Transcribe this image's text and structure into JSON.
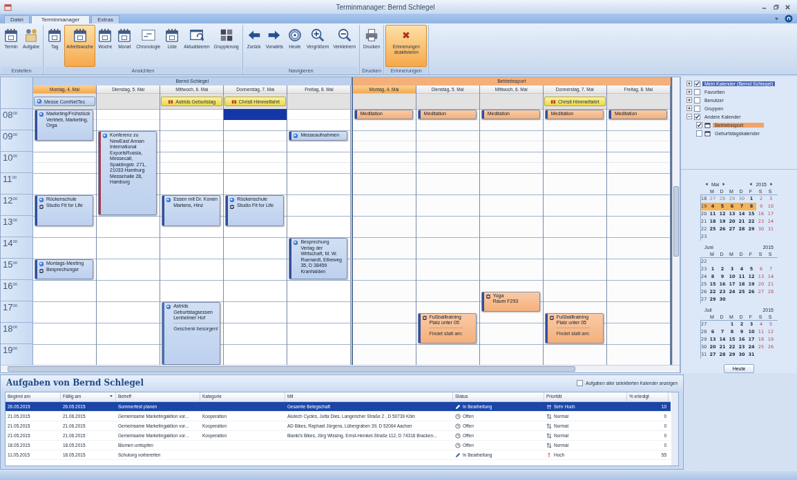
{
  "window": {
    "title": "Terminmanager: Bernd Schlegel"
  },
  "ribbon": {
    "tabs": [
      {
        "label": "Datei",
        "selected": false
      },
      {
        "label": "Terminmanager",
        "selected": true
      },
      {
        "label": "Extras",
        "selected": false
      }
    ],
    "groups": [
      {
        "label": "Erstellen",
        "buttons": [
          {
            "label": "Termin",
            "kind": "appointment",
            "selected": false
          },
          {
            "label": "Aufgabe",
            "kind": "task",
            "selected": false
          }
        ]
      },
      {
        "label": "Ansichten",
        "buttons": [
          {
            "label": "Tag",
            "kind": "day",
            "selected": false
          },
          {
            "label": "Arbeitswoche",
            "kind": "workweek",
            "selected": true
          },
          {
            "label": "Woche",
            "kind": "week",
            "selected": false
          },
          {
            "label": "Monat",
            "kind": "month",
            "selected": false
          },
          {
            "label": "Chronologie",
            "kind": "timeline",
            "selected": false
          },
          {
            "label": "Liste",
            "kind": "list",
            "selected": false
          },
          {
            "label": "Aktualisieren",
            "kind": "refresh",
            "selected": false
          },
          {
            "label": "Gruppierung",
            "kind": "grouping",
            "selected": false
          }
        ]
      },
      {
        "label": "Navigieren",
        "buttons": [
          {
            "label": "Zurück",
            "kind": "back",
            "selected": false
          },
          {
            "label": "Vorwärts",
            "kind": "forward",
            "selected": false
          },
          {
            "label": "Heute",
            "kind": "today",
            "selected": false
          },
          {
            "label": "Vergrößern",
            "kind": "zoom-in",
            "selected": false
          },
          {
            "label": "Verkleinern",
            "kind": "zoom-out",
            "selected": false
          }
        ]
      },
      {
        "label": "Drucken",
        "buttons": [
          {
            "label": "Drucken",
            "kind": "print",
            "selected": false
          }
        ]
      },
      {
        "label": "Erinnerungen",
        "buttons": [
          {
            "label": "Erinnerungen deaktivieren",
            "kind": "reminder-off",
            "selected": true
          }
        ]
      }
    ]
  },
  "calendar": {
    "hours": [
      "08$^{00}$",
      "09$^{00}$",
      "10$^{00}$",
      "11$^{00}$",
      "12$^{00}$",
      "13$^{00}$",
      "14$^{00}$",
      "15$^{00}$",
      "16$^{00}$",
      "17$^{00}$",
      "18$^{00}$",
      "19$^{00}$"
    ],
    "groups": [
      {
        "name": "Bernd Schlegel",
        "color": "#bcd0ee",
        "days": [
          {
            "label": "Montag, 4. Mai",
            "today": true,
            "selection": false,
            "all_day": [
              {
                "title": "Messe ComNetTec",
                "kind": "event"
              }
            ],
            "events": [
              {
                "title": "Marketing/Frühstück",
                "lines": [
                  "Vertrieb, Marketing, Orga"
                ],
                "recurring": false,
                "color": "#2f4f9e"
              },
              {
                "title": "Rückenschule",
                "lines": [
                  "Studio Fit for Life"
                ],
                "recurring": true,
                "color": "#2f4f9e"
              },
              {
                "title": "Montags-Meeting",
                "lines": [
                  "Besprechungsr"
                ],
                "recurring": true,
                "color": "#2f4f9e"
              }
            ]
          },
          {
            "label": "Dienstag, 5. Mai",
            "today": false,
            "selection": false,
            "events": [
              {
                "title": "Konferenz zu NewEast Annan International",
                "lines": [
                  "ExportsRussia, Messecall, Spaldingstr. 271, 21033 Hamburg",
                  "Messehalle 28, Hamburg"
                ],
                "recurring": false,
                "color": "#a33a48"
              }
            ]
          },
          {
            "label": "Mittwoch, 6. Mai",
            "today": false,
            "selection": false,
            "all_day": [
              {
                "title": "Astrids Geburtstag",
                "kind": "holiday"
              }
            ],
            "events": [
              {
                "title": "Essen mit Dr. Konen Martens, Hinz",
                "recurring": false,
                "color": "#2f4f9e"
              },
              {
                "title": "Astrids Geburtstagsessen Lenheimer Hof",
                "note": "Geschenk besorgen!",
                "recurring": false,
                "color": "#4a6fb5"
              }
            ]
          },
          {
            "label": "Donnerstag, 7. Mai",
            "today": false,
            "selection": true,
            "all_day": [
              {
                "title": "Christi Himmelfahrt",
                "kind": "holiday"
              }
            ],
            "events": [
              {
                "title": "Rückenschule",
                "lines": [
                  "Studio Fit for Life"
                ],
                "recurring": true,
                "color": "#2f4f9e"
              }
            ]
          },
          {
            "label": "Freitag, 8. Mai",
            "today": false,
            "selection": false,
            "events": [
              {
                "title": "Messeaufnahmen",
                "recurring": false,
                "color": "#2f4f9e"
              },
              {
                "title": "Besprechung",
                "lines": [
                  "Verlag der Wirtschaft, M. W. Ruenardt, Elbeweg 35, D 38459 Kranhalden"
                ],
                "recurring": false,
                "color": "#2f4f9e"
              }
            ]
          }
        ]
      },
      {
        "name": "Betriebssport",
        "color": "#f5b07a",
        "days": [
          {
            "label": "Montag, 4. Mai",
            "today": true,
            "selection": false,
            "events": [
              {
                "title": "Meditation",
                "recurring": false,
                "color": "#2f4f9e"
              }
            ]
          },
          {
            "label": "Dienstag, 5. Mai",
            "today": false,
            "selection": false,
            "events": [
              {
                "title": "Meditation",
                "recurring": false,
                "color": "#2f4f9e"
              },
              {
                "title": "Fußballtraining",
                "lines": [
                  "Platz unter 05"
                ],
                "note": "Findet statt am:",
                "recurring": true,
                "color": "#2f4f9e"
              }
            ]
          },
          {
            "label": "Mittwoch, 6. Mai",
            "today": false,
            "selection": false,
            "events": [
              {
                "title": "Meditation",
                "recurring": false,
                "color": "#2f4f9e"
              },
              {
                "title": "Yoga",
                "lines": [
                  "Raum F293"
                ],
                "recurring": true,
                "color": "#2f4f9e"
              }
            ]
          },
          {
            "label": "Donnerstag, 7. Mai",
            "today": false,
            "selection": false,
            "all_day": [
              {
                "title": "Christi Himmelfahrt",
                "kind": "holiday"
              }
            ],
            "events": [
              {
                "title": "Meditation",
                "recurring": false,
                "color": "#2f4f9e"
              },
              {
                "title": "Fußballtraining",
                "lines": [
                  "Platz unter 05"
                ],
                "note": "Findet statt am:",
                "recurring": true,
                "color": "#2f4f9e"
              }
            ]
          },
          {
            "label": "Freitag, 8. Mai",
            "today": false,
            "selection": false,
            "events": [
              {
                "title": "Meditation",
                "recurring": false,
                "color": "#2f4f9e"
              }
            ]
          }
        ]
      }
    ]
  },
  "navigator": {
    "tree": [
      {
        "label": "Mein Kalender (Bernd Schlegel)",
        "checked": true,
        "selected": true,
        "expanded": false
      },
      {
        "label": "Favoriten",
        "checked": false,
        "selected": false,
        "expanded": false
      },
      {
        "label": "Benutzer",
        "checked": false,
        "selected": false,
        "expanded": false
      },
      {
        "label": "Gruppen",
        "checked": false,
        "selected": false,
        "expanded": false
      },
      {
        "label": "Andere Kalender",
        "checked": true,
        "selected": false,
        "expanded": true,
        "children": [
          {
            "label": "Betriebssport",
            "checked": true,
            "selected": true
          },
          {
            "label": "Geburtstagskalender",
            "checked": false,
            "selected": false
          }
        ]
      }
    ],
    "months": [
      {
        "month": "Mai",
        "year": "2015",
        "weekdays": [
          "M",
          "D",
          "M",
          "D",
          "F",
          "S",
          "S"
        ],
        "weeks": [
          {
            "week": "18",
            "selected": false,
            "days": [
              {
                "d": "27",
                "kind": "other"
              },
              {
                "d": "28",
                "kind": "other"
              },
              {
                "d": "29",
                "kind": "other"
              },
              {
                "d": "30",
                "kind": "other"
              },
              {
                "d": "1",
                "kind": "day"
              },
              {
                "d": "2",
                "kind": "weekend"
              },
              {
                "d": "3",
                "kind": "weekend"
              }
            ]
          },
          {
            "week": "19",
            "selected": true,
            "days": [
              {
                "d": "4",
                "kind": "day"
              },
              {
                "d": "5",
                "kind": "day"
              },
              {
                "d": "6",
                "kind": "day"
              },
              {
                "d": "7",
                "kind": "day"
              },
              {
                "d": "8",
                "kind": "day"
              },
              {
                "d": "9",
                "kind": "weekend"
              },
              {
                "d": "10",
                "kind": "weekend"
              }
            ]
          },
          {
            "week": "20",
            "selected": false,
            "days": [
              {
                "d": "11",
                "kind": "day"
              },
              {
                "d": "12",
                "kind": "day"
              },
              {
                "d": "13",
                "kind": "day"
              },
              {
                "d": "14",
                "kind": "day"
              },
              {
                "d": "15",
                "kind": "day"
              },
              {
                "d": "16",
                "kind": "weekend"
              },
              {
                "d": "17",
                "kind": "weekend"
              }
            ]
          },
          {
            "week": "21",
            "selected": false,
            "days": [
              {
                "d": "18",
                "kind": "day"
              },
              {
                "d": "19",
                "kind": "day"
              },
              {
                "d": "20",
                "kind": "day"
              },
              {
                "d": "21",
                "kind": "day"
              },
              {
                "d": "22",
                "kind": "day"
              },
              {
                "d": "23",
                "kind": "weekend"
              },
              {
                "d": "24",
                "kind": "weekend"
              }
            ]
          },
          {
            "week": "22",
            "selected": false,
            "days": [
              {
                "d": "25",
                "kind": "day"
              },
              {
                "d": "26",
                "kind": "day"
              },
              {
                "d": "27",
                "kind": "day"
              },
              {
                "d": "28",
                "kind": "day"
              },
              {
                "d": "29",
                "kind": "day"
              },
              {
                "d": "30",
                "kind": "weekend"
              },
              {
                "d": "31",
                "kind": "weekend"
              }
            ]
          },
          {
            "week": "23",
            "selected": false
          }
        ]
      },
      {
        "month": "Juni",
        "year": "2015",
        "weekdays": [
          "M",
          "D",
          "M",
          "D",
          "F",
          "S",
          "S"
        ],
        "weeks": [
          {
            "week": "22",
            "selected": false
          },
          {
            "week": "23",
            "selected": false,
            "days": [
              {
                "d": "1",
                "kind": "day"
              },
              {
                "d": "2",
                "kind": "day"
              },
              {
                "d": "3",
                "kind": "day"
              },
              {
                "d": "4",
                "kind": "day"
              },
              {
                "d": "5",
                "kind": "day"
              },
              {
                "d": "6",
                "kind": "weekend"
              },
              {
                "d": "7",
                "kind": "weekend"
              }
            ]
          },
          {
            "week": "24",
            "selected": false,
            "days": [
              {
                "d": "8",
                "kind": "day"
              },
              {
                "d": "9",
                "kind": "day"
              },
              {
                "d": "10",
                "kind": "day"
              },
              {
                "d": "11",
                "kind": "day"
              },
              {
                "d": "12",
                "kind": "day"
              },
              {
                "d": "13",
                "kind": "weekend"
              },
              {
                "d": "14",
                "kind": "weekend"
              }
            ]
          },
          {
            "week": "25",
            "selected": false,
            "days": [
              {
                "d": "15",
                "kind": "day"
              },
              {
                "d": "16",
                "kind": "day"
              },
              {
                "d": "17",
                "kind": "day"
              },
              {
                "d": "18",
                "kind": "day"
              },
              {
                "d": "19",
                "kind": "day"
              },
              {
                "d": "20",
                "kind": "weekend"
              },
              {
                "d": "21",
                "kind": "weekend"
              }
            ]
          },
          {
            "week": "26",
            "selected": false,
            "days": [
              {
                "d": "22",
                "kind": "day"
              },
              {
                "d": "23",
                "kind": "day"
              },
              {
                "d": "24",
                "kind": "day"
              },
              {
                "d": "25",
                "kind": "day"
              },
              {
                "d": "26",
                "kind": "day"
              },
              {
                "d": "27",
                "kind": "weekend"
              },
              {
                "d": "28",
                "kind": "weekend"
              }
            ]
          },
          {
            "week": "27",
            "selected": false,
            "days": [
              {
                "d": "29",
                "kind": "day"
              },
              {
                "d": "30",
                "kind": "day"
              }
            ]
          }
        ]
      },
      {
        "month": "Juli",
        "year": "2015",
        "weekdays": [
          "M",
          "D",
          "M",
          "D",
          "F",
          "S",
          "S"
        ],
        "weeks": [
          {
            "week": "27",
            "selected": false,
            "days": [
              {
                "d": "1",
                "kind": "day"
              },
              {
                "d": "2",
                "kind": "day"
              },
              {
                "d": "3",
                "kind": "day"
              },
              {
                "d": "4",
                "kind": "weekend"
              },
              {
                "d": "5",
                "kind": "weekend"
              }
            ]
          },
          {
            "week": "28",
            "selected": false,
            "days": [
              {
                "d": "6",
                "kind": "day"
              },
              {
                "d": "7",
                "kind": "day"
              },
              {
                "d": "8",
                "kind": "day"
              },
              {
                "d": "9",
                "kind": "day"
              },
              {
                "d": "10",
                "kind": "day"
              },
              {
                "d": "11",
                "kind": "weekend"
              },
              {
                "d": "12",
                "kind": "weekend"
              }
            ]
          },
          {
            "week": "29",
            "selected": false,
            "days": [
              {
                "d": "13",
                "kind": "day"
              },
              {
                "d": "14",
                "kind": "day"
              },
              {
                "d": "15",
                "kind": "day"
              },
              {
                "d": "16",
                "kind": "day"
              },
              {
                "d": "17",
                "kind": "day"
              },
              {
                "d": "18",
                "kind": "weekend"
              },
              {
                "d": "19",
                "kind": "weekend"
              }
            ]
          },
          {
            "week": "30",
            "selected": false,
            "days": [
              {
                "d": "20",
                "kind": "day"
              },
              {
                "d": "21",
                "kind": "day"
              },
              {
                "d": "22",
                "kind": "day"
              },
              {
                "d": "23",
                "kind": "day"
              },
              {
                "d": "24",
                "kind": "day"
              },
              {
                "d": "25",
                "kind": "weekend"
              },
              {
                "d": "26",
                "kind": "weekend"
              }
            ]
          },
          {
            "week": "31",
            "selected": false,
            "days": [
              {
                "d": "27",
                "kind": "day"
              },
              {
                "d": "28",
                "kind": "day"
              },
              {
                "d": "29",
                "kind": "day"
              },
              {
                "d": "30",
                "kind": "day"
              },
              {
                "d": "31",
                "kind": "day"
              }
            ]
          }
        ]
      }
    ],
    "today_button": "Heute"
  },
  "tasks": {
    "title": "Aufgaben von Bernd Schlegel",
    "show_all": {
      "label": "Aufgaben aller selektierten Kalender anzeigen",
      "checked": false
    },
    "columns": [
      "Beginnt am",
      "Fällig am",
      "Betreff",
      "Kategorie",
      "Mit",
      "Status",
      "Priorität",
      "% erledigt"
    ],
    "rows": [
      {
        "selected": true,
        "begins": "26.05.2015",
        "due": "26.05.2015",
        "subject": "Sommerfest planen",
        "with": "Gesamte Belegschaft",
        "status": {
          "label": "In Bearbeitung",
          "kind": "progress"
        },
        "priority": {
          "label": "Sehr Hoch",
          "kind": "very-high"
        },
        "percent": "10"
      },
      {
        "selected": false,
        "begins": "21.05.2015",
        "due": "21.06.2015",
        "subject": "Gemeinsame Marketingaktion vor...",
        "category": "Kooperation",
        "with": "Alutech Cycles, Jutta Dies, Langericher Straße 2 , D 50739 Köln",
        "status": {
          "label": "Offen",
          "kind": "open"
        },
        "priority": {
          "label": "Normal",
          "kind": "normal"
        },
        "percent": "0"
      },
      {
        "selected": false,
        "begins": "21.05.2015",
        "due": "21.06.2015",
        "subject": "Gemeinsame Marketingaktion vor...",
        "category": "Kooperation",
        "with": "AD Bikes, Raphael Jürgens, Lübergraben 39, D 52064 Aachen",
        "status": {
          "label": "Offen",
          "kind": "open"
        },
        "priority": {
          "label": "Normal",
          "kind": "normal"
        },
        "percent": "0"
      },
      {
        "selected": false,
        "begins": "21.05.2015",
        "due": "21.06.2015",
        "subject": "Gemeinsame Marketingaktion vor...",
        "category": "Kooperation",
        "with": "Bianki's Bikes, Jörg Wissing, Ernst-Heinkel-Straße 112, D 74316 Bracken...",
        "status": {
          "label": "Offen",
          "kind": "open"
        },
        "priority": {
          "label": "Normal",
          "kind": "normal"
        },
        "percent": "0"
      },
      {
        "selected": false,
        "begins": "18.05.2015",
        "due": "18.05.2015",
        "subject": "Blumen umtopfen",
        "status": {
          "label": "Offen",
          "kind": "open"
        },
        "priority": {
          "label": "Normal",
          "kind": "normal"
        },
        "percent": "0"
      },
      {
        "selected": false,
        "begins": "11.05.2015",
        "due": "18.05.2015",
        "subject": "Schulung vorbereiten",
        "status": {
          "label": "In Bearbeitung",
          "kind": "progress"
        },
        "priority": {
          "label": "Hoch",
          "kind": "high"
        },
        "percent": "55"
      }
    ]
  }
}
